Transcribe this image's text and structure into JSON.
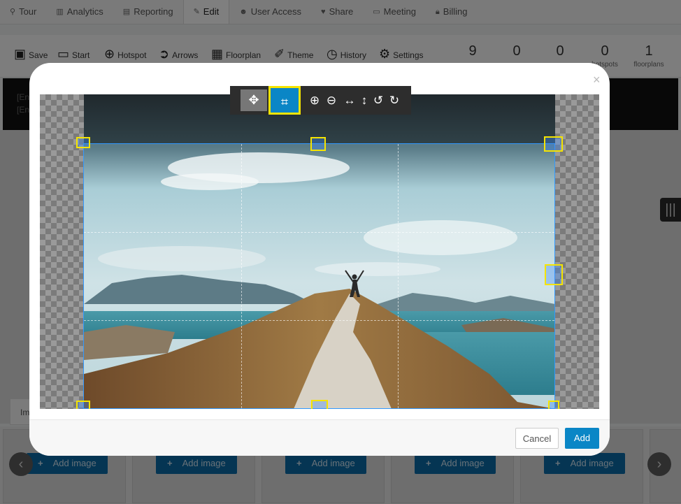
{
  "topnav": {
    "tabs": [
      {
        "label": "Tour",
        "icon": "map-marker-icon"
      },
      {
        "label": "Analytics",
        "icon": "bar-chart-icon"
      },
      {
        "label": "Reporting",
        "icon": "line-chart-icon"
      },
      {
        "label": "Edit",
        "icon": "pencil-icon"
      },
      {
        "label": "User Access",
        "icon": "users-icon"
      },
      {
        "label": "Share",
        "icon": "heart-icon"
      },
      {
        "label": "Meeting",
        "icon": "monitor-icon"
      },
      {
        "label": "Billing",
        "icon": "lock-icon"
      }
    ],
    "active": "Edit"
  },
  "toolbar": {
    "items": [
      {
        "label": "Save",
        "icon": "save-icon"
      },
      {
        "label": "Start",
        "icon": "monitor-icon"
      },
      {
        "label": "Hotspot",
        "icon": "plus-circle-icon"
      },
      {
        "label": "Arrows",
        "icon": "arrow-circle-icon"
      },
      {
        "label": "Floorplan",
        "icon": "floorplan-icon"
      },
      {
        "label": "Theme",
        "icon": "brush-icon"
      },
      {
        "label": "History",
        "icon": "clock-icon"
      },
      {
        "label": "Settings",
        "icon": "gear-icon"
      }
    ],
    "stats": [
      {
        "value": "9",
        "label": ""
      },
      {
        "value": "0",
        "label": ""
      },
      {
        "value": "0",
        "label": ""
      },
      {
        "value": "0",
        "label": "hotspots"
      },
      {
        "value": "1",
        "label": "floorplans"
      }
    ]
  },
  "background": {
    "blackbar_lines": [
      "[En",
      "[En"
    ],
    "image_tab": "Im",
    "add_image_label": "Add image",
    "slots_count_label": ""
  },
  "modal": {
    "close_glyph": "×",
    "cancel_label": "Cancel",
    "add_label": "Add",
    "crop_tools": [
      "move-icon",
      "crop-icon",
      "zoom-in-icon",
      "zoom-out-icon",
      "flip-horizontal-icon",
      "flip-vertical-icon",
      "rotate-left-icon",
      "rotate-right-icon"
    ]
  },
  "colors": {
    "accent": "#0a86c6",
    "handle_highlight": "#f5e400",
    "crop_border": "#3399ff"
  }
}
